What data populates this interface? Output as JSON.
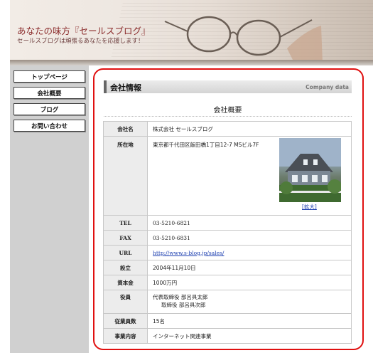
{
  "header": {
    "title": "あなたの味方『セールスブログ』",
    "subtitle": "セールスブログは頑張るあなたを応援します！"
  },
  "sidebar": {
    "items": [
      {
        "label": "トップページ"
      },
      {
        "label": "会社概要"
      },
      {
        "label": "ブログ"
      },
      {
        "label": "お問い合わせ"
      }
    ]
  },
  "main": {
    "section_title": "会社情報",
    "section_title_en": "Company data",
    "subheading": "会社概要",
    "photo_link": "[拡大]",
    "rows": [
      {
        "label": "会社名",
        "value": "株式会社 セールスブログ"
      },
      {
        "label": "所在地",
        "value": "東京都千代田区飯田橋1丁目12-7 MSビル7F"
      },
      {
        "label": "TEL",
        "value": "03-5210-6821"
      },
      {
        "label": "FAX",
        "value": "03-5210-6831"
      },
      {
        "label": "URL",
        "value": "http://www.s-blog.jp/sales/"
      },
      {
        "label": "設立",
        "value": "2004年11月10日"
      },
      {
        "label": "資本金",
        "value": "1000万円"
      },
      {
        "label": "役員",
        "value_lines": [
          "代表取締役 部呂具太郎",
          "取締役 部呂具次郎"
        ]
      },
      {
        "label": "従業員数",
        "value": "15名"
      },
      {
        "label": "事業内容",
        "value": "インターネット関連事業"
      }
    ]
  },
  "colors": {
    "highlight": "#e01010",
    "header_title": "#8a2a2a",
    "sidebar_bg": "#d0d0d0",
    "link": "#1c3fb0"
  }
}
